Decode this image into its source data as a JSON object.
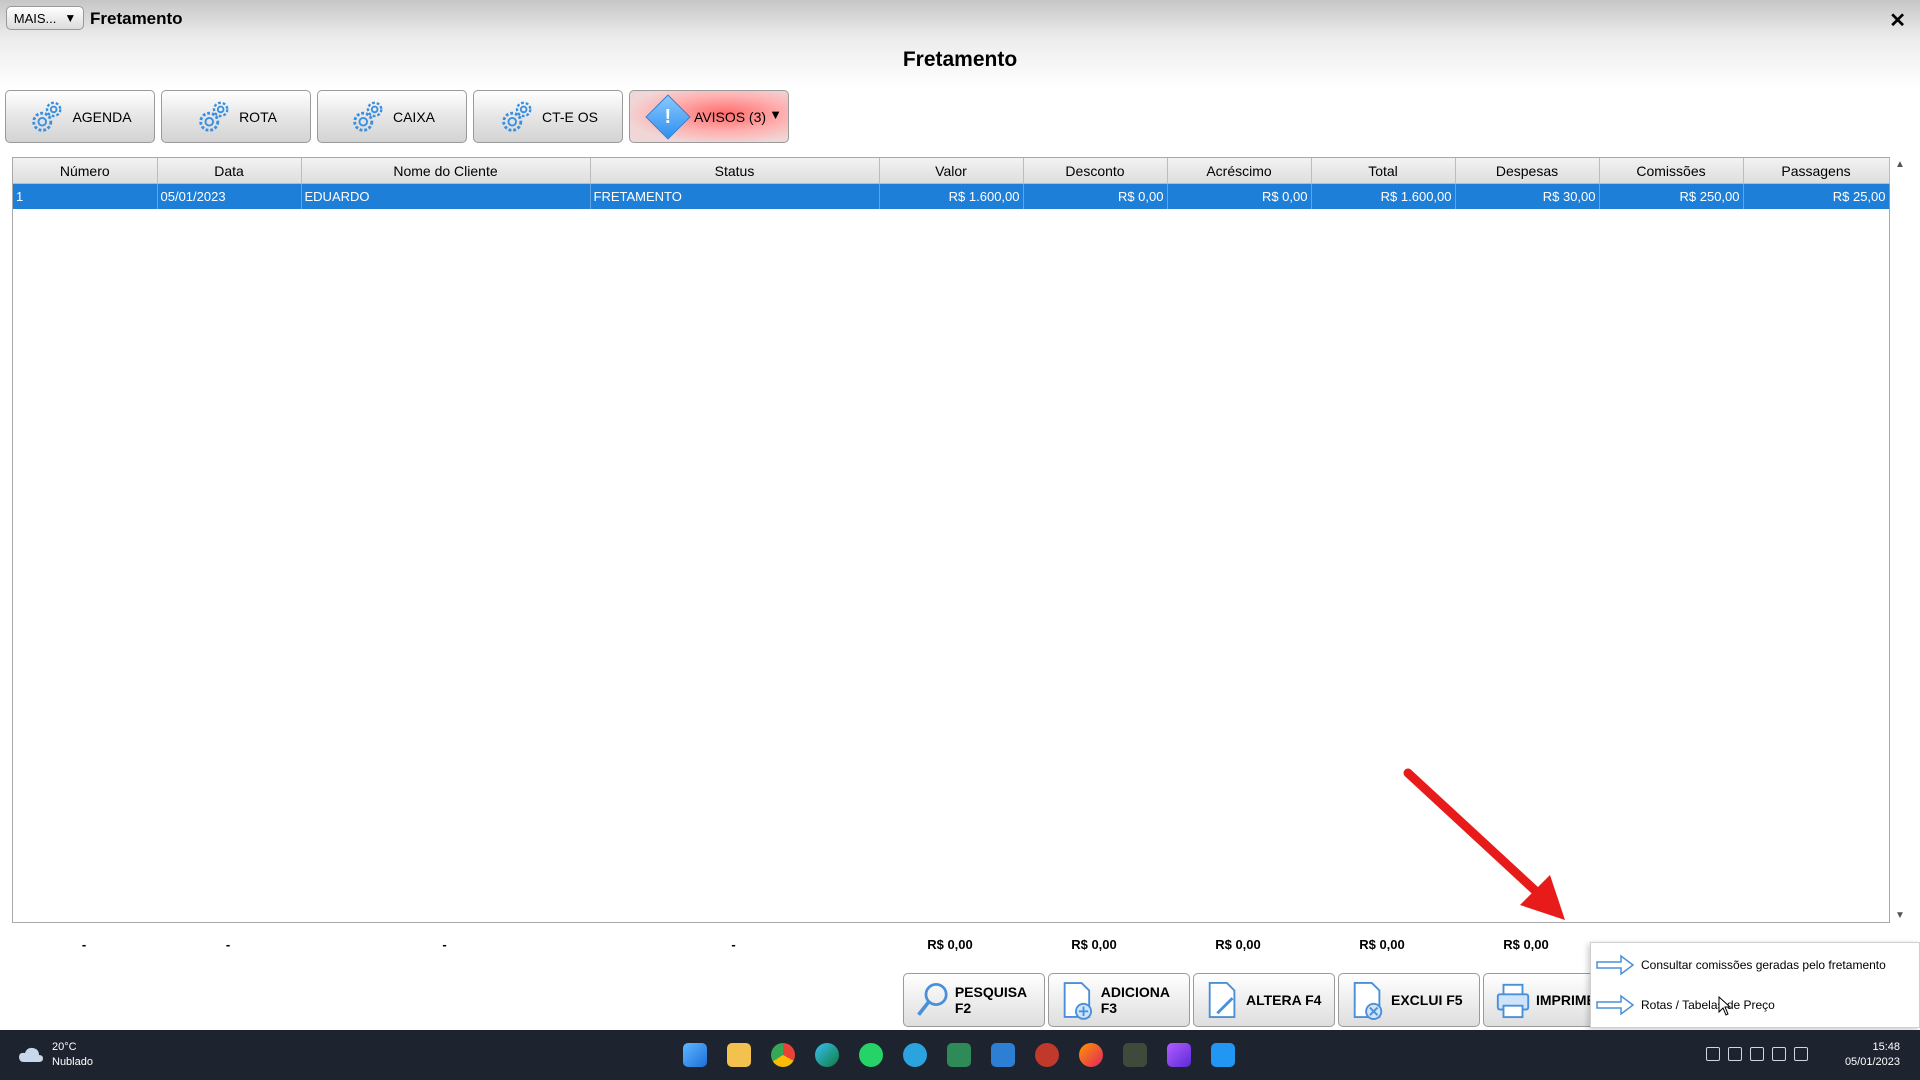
{
  "window": {
    "mais_label": "MAIS...",
    "title": "Fretamento",
    "close_glyph": "✕"
  },
  "page_title": "Fretamento",
  "toolbar": [
    {
      "label": "AGENDA",
      "icon": "gear-icon"
    },
    {
      "label": "ROTA",
      "icon": "gear-icon"
    },
    {
      "label": "CAIXA",
      "icon": "gear-icon"
    },
    {
      "label": "CT-E OS",
      "icon": "gear-icon"
    },
    {
      "label": "AVISOS (3)",
      "icon": "warning-icon",
      "highlight": "#ff6b6b"
    }
  ],
  "grid": {
    "columns": [
      "Número",
      "Data",
      "Nome do Cliente",
      "Status",
      "Valor",
      "Desconto",
      "Acréscimo",
      "Total",
      "Despesas",
      "Comissões",
      "Passagens"
    ],
    "rows": [
      [
        "1",
        "05/01/2023",
        "EDUARDO",
        "FRETAMENTO",
        "R$ 1.600,00",
        "R$ 0,00",
        "R$ 0,00",
        "R$ 1.600,00",
        "R$ 30,00",
        "R$ 250,00",
        "R$ 25,00"
      ]
    ],
    "selected_color": "#1e7fd8"
  },
  "totals": [
    "-",
    "-",
    "-",
    "-",
    "R$ 0,00",
    "R$ 0,00",
    "R$ 0,00",
    "R$ 0,00",
    "R$ 0,00"
  ],
  "bottom_buttons": [
    {
      "label": "PESQUISA F2",
      "icon": "search-icon"
    },
    {
      "label": "ADICIONA F3",
      "icon": "document-add-icon"
    },
    {
      "label": "ALTERA F4",
      "icon": "document-edit-icon"
    },
    {
      "label": "EXCLUI F5",
      "icon": "document-delete-icon"
    },
    {
      "label": "IMPRIME",
      "icon": "printer-icon"
    }
  ],
  "context_menu": [
    {
      "label": "Consultar comissões geradas pelo fretamento",
      "icon": "arrow-right-icon"
    },
    {
      "label": "Rotas / Tabelas de Preço",
      "icon": "arrow-right-icon"
    }
  ],
  "taskbar": {
    "weather_temp": "20°C",
    "weather_desc": "Nublado",
    "time": "15:48",
    "date": "05/01/2023"
  }
}
